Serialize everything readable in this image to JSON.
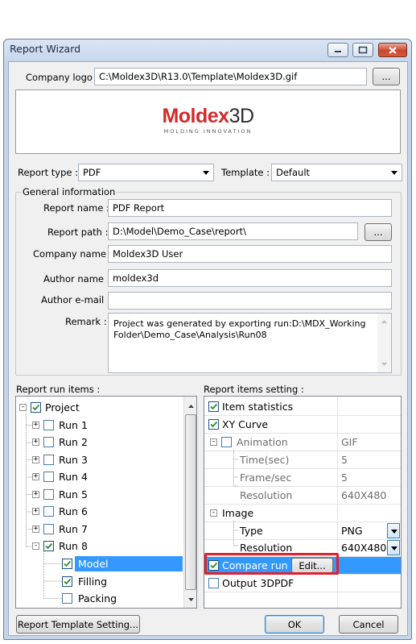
{
  "window": {
    "title": "Report Wizard"
  },
  "company_logo": {
    "label": "Company logo :",
    "path": "C:\\Moldex3D\\R13.0\\Template\\Moldex3D.gif",
    "browse": "..."
  },
  "logo": {
    "brand": "Moldex",
    "brand_suffix": "3D",
    "tagline": "MOLDING INNOVATION",
    "brand_color": "#d22b2b",
    "suffix_color": "#2e2e2e"
  },
  "report_type": {
    "label": "Report type :",
    "value": "PDF"
  },
  "template": {
    "label": "Template :",
    "value": "Default"
  },
  "general": {
    "legend": "General information",
    "report_name": {
      "label": "Report name :",
      "value": "PDF Report"
    },
    "report_path": {
      "label": "Report path :",
      "value": "D:\\Model\\Demo_Case\\report\\",
      "browse": "..."
    },
    "company_name": {
      "label": "Company name :",
      "value": "Moldex3D User"
    },
    "author_name": {
      "label": "Author name :",
      "value": "moldex3d"
    },
    "author_email": {
      "label": "Author e-mail :",
      "value": ""
    },
    "remark": {
      "label": "Remark :",
      "value": "Project was generated by exporting run:D:\\MDX_WorkingFolder\\Demo_Case\\Analysis\\Run08"
    }
  },
  "run_items": {
    "label": "Report run items :",
    "project": "Project",
    "runs": [
      "Run 1",
      "Run 2",
      "Run 3",
      "Run 4",
      "Run 5",
      "Run 6",
      "Run 7",
      "Run 8"
    ],
    "run8_children": [
      "Model",
      "Filling",
      "Packing"
    ]
  },
  "items_setting": {
    "label": "Report items setting :",
    "item_statistics": "Item statistics",
    "xy_curve": "XY Curve",
    "animation": {
      "label": "Animation",
      "value": "GIF"
    },
    "time": {
      "label": "Time(sec)",
      "value": "5"
    },
    "frame": {
      "label": "Frame/sec",
      "value": "5"
    },
    "anim_resolution": {
      "label": "Resolution",
      "value": "640X480"
    },
    "image": "Image",
    "image_type": {
      "label": "Type",
      "value": "PNG"
    },
    "image_resolution": {
      "label": "Resolution",
      "value": "640X480"
    },
    "compare_run": "Compare run",
    "edit": "Edit...",
    "output_3dpdf": "Output 3DPDF"
  },
  "footer": {
    "template_setting": "Report Template Setting...",
    "ok": "OK",
    "cancel": "Cancel"
  },
  "colors": {
    "selection": "#3399ff",
    "highlight_box": "#e0202a"
  }
}
